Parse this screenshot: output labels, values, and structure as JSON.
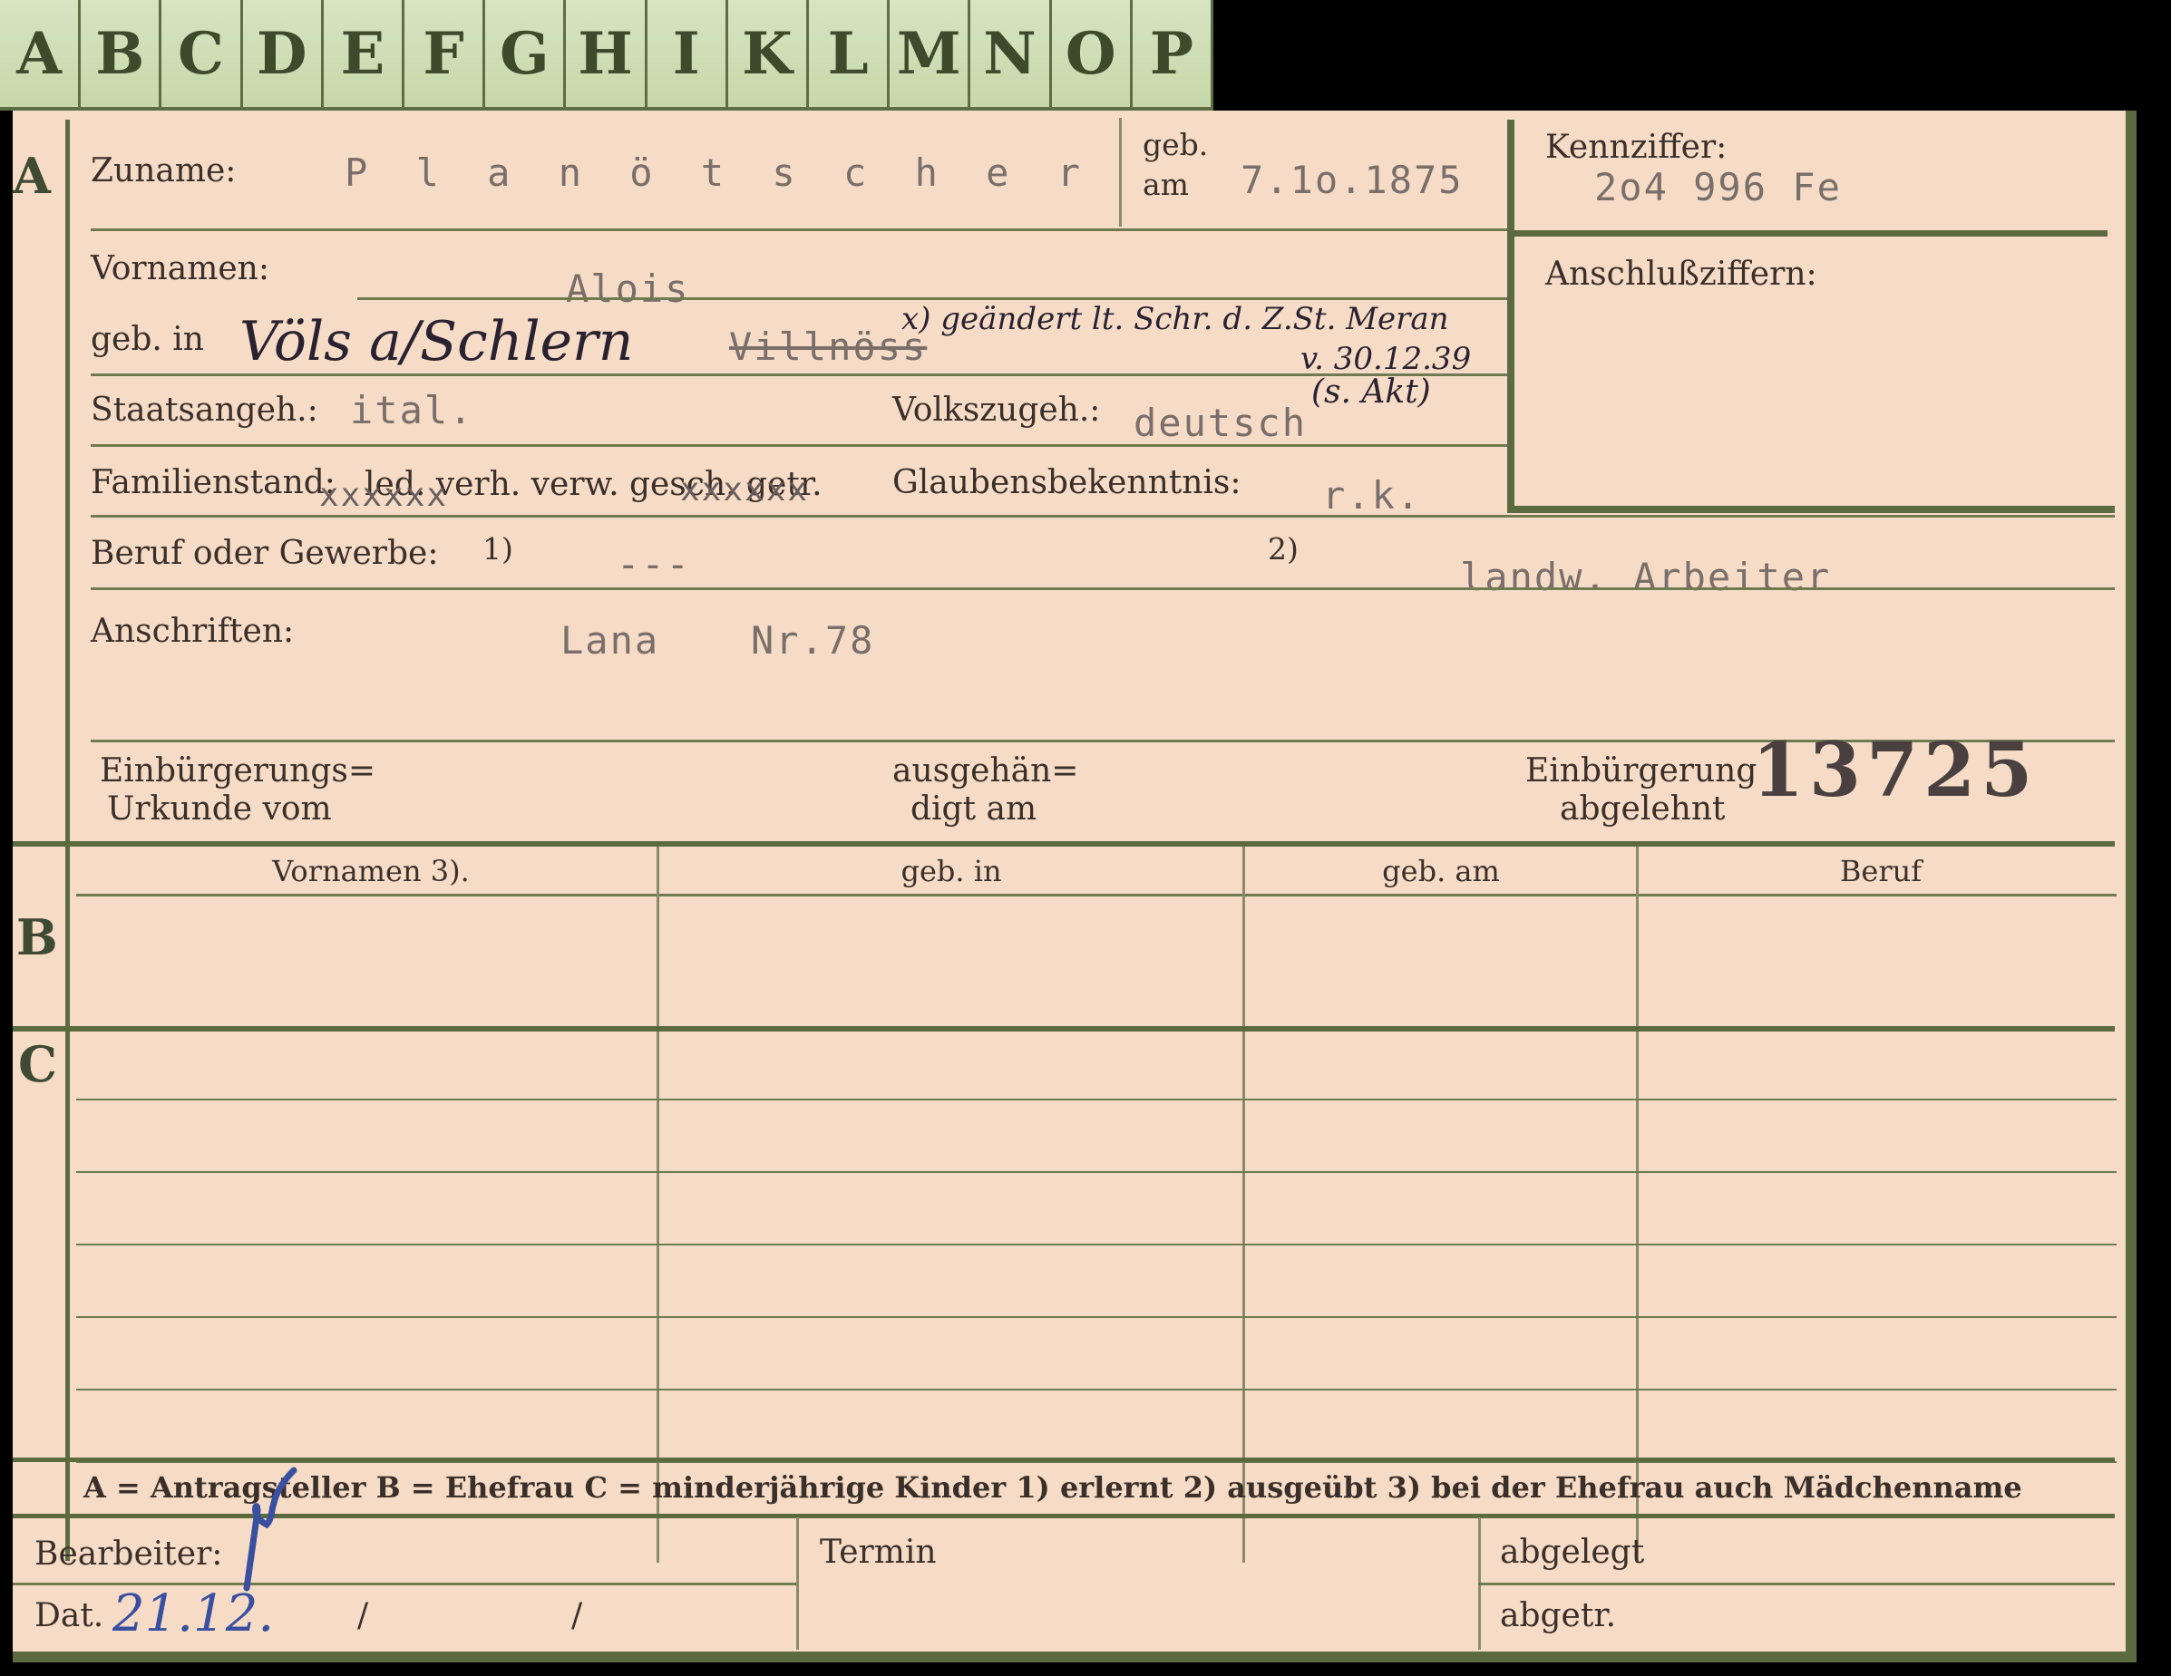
{
  "tabs": [
    "A",
    "B",
    "C",
    "D",
    "E",
    "F",
    "G",
    "H",
    "I",
    "K",
    "L",
    "M",
    "N",
    "O",
    "P"
  ],
  "sections": {
    "a": "A",
    "b": "B",
    "c": "C"
  },
  "labels": {
    "zuname": "Zuname:",
    "geb_am_top": "geb.",
    "geb_am_bottom": "am",
    "kennziffer": "Kennziffer:",
    "anschlussziffern": "Anschlußziffern:",
    "vornamen": "Vornamen:",
    "geb_in": "geb. in",
    "staatsangeh": "Staatsangeh.:",
    "volkszugeh": "Volkszugeh.:",
    "familienstand": "Familienstand:",
    "familienstand_options": "led. verh. verw. gesch. getr.",
    "familienstand_mark": "xxxxxx",
    "familienstand_mark2": "xxxxxx",
    "glaubensbekenntnis": "Glaubensbekenntnis:",
    "beruf": "Beruf oder Gewerbe:",
    "beruf_note1": "1)",
    "beruf_note2": "2)",
    "anschriften": "Anschriften:",
    "einbuergerung_urkunde_1": "Einbürgerungs=",
    "einbuergerung_urkunde_2": "Urkunde vom",
    "ausgehaendigt_1": "ausgehän=",
    "ausgehaendigt_2": "digt am",
    "einbuergerung_abgelehnt_1": "Einbürgerung",
    "einbuergerung_abgelehnt_2": "abgelehnt"
  },
  "values": {
    "zuname": "P l a n ö t s c h e r",
    "geb_am": "7.1o.1875",
    "kennziffer": "2o4 996 Fe",
    "vornamen": "Alois",
    "geb_in_hand": "Völs a/Schlern",
    "geb_in_typed_struck": "Villnöss",
    "correction_note": "x) geändert lt. Schr. d. Z.St. Meran",
    "correction_date": "v. 30.12.39",
    "staatsangeh": "ital.",
    "volkszugeh": "deutsch",
    "volkszugeh_note": "(s. Akt)",
    "glaube": "r.k.",
    "beruf1": "---",
    "beruf2": "landw. Arbeiter",
    "anschrift_ort": "Lana",
    "anschrift_nr": "Nr.78",
    "aktenzahl": "13725"
  },
  "table_headers": {
    "vornamen": "Vornamen 3).",
    "geb_in": "geb. in",
    "geb_am": "geb. am",
    "beruf": "Beruf"
  },
  "legend": "A = Antragsteller   B = Ehefrau   C = minderjährige Kinder   1) erlernt   2) ausgeübt   3) bei der Ehefrau auch Mädchenname",
  "footer": {
    "bearbeiter": "Bearbeiter:",
    "termin": "Termin",
    "abgelegt": "abgelegt",
    "dat": "Dat.",
    "dat_value": "21.12.",
    "slash1": "/",
    "slash2": "/",
    "abgetr": "abgetr."
  },
  "colors": {
    "card": "#f6dcc6",
    "border_green": "#5b6a3f",
    "tab_green": "#cfe0b7",
    "pencil_blue": "#3a4fa0"
  }
}
